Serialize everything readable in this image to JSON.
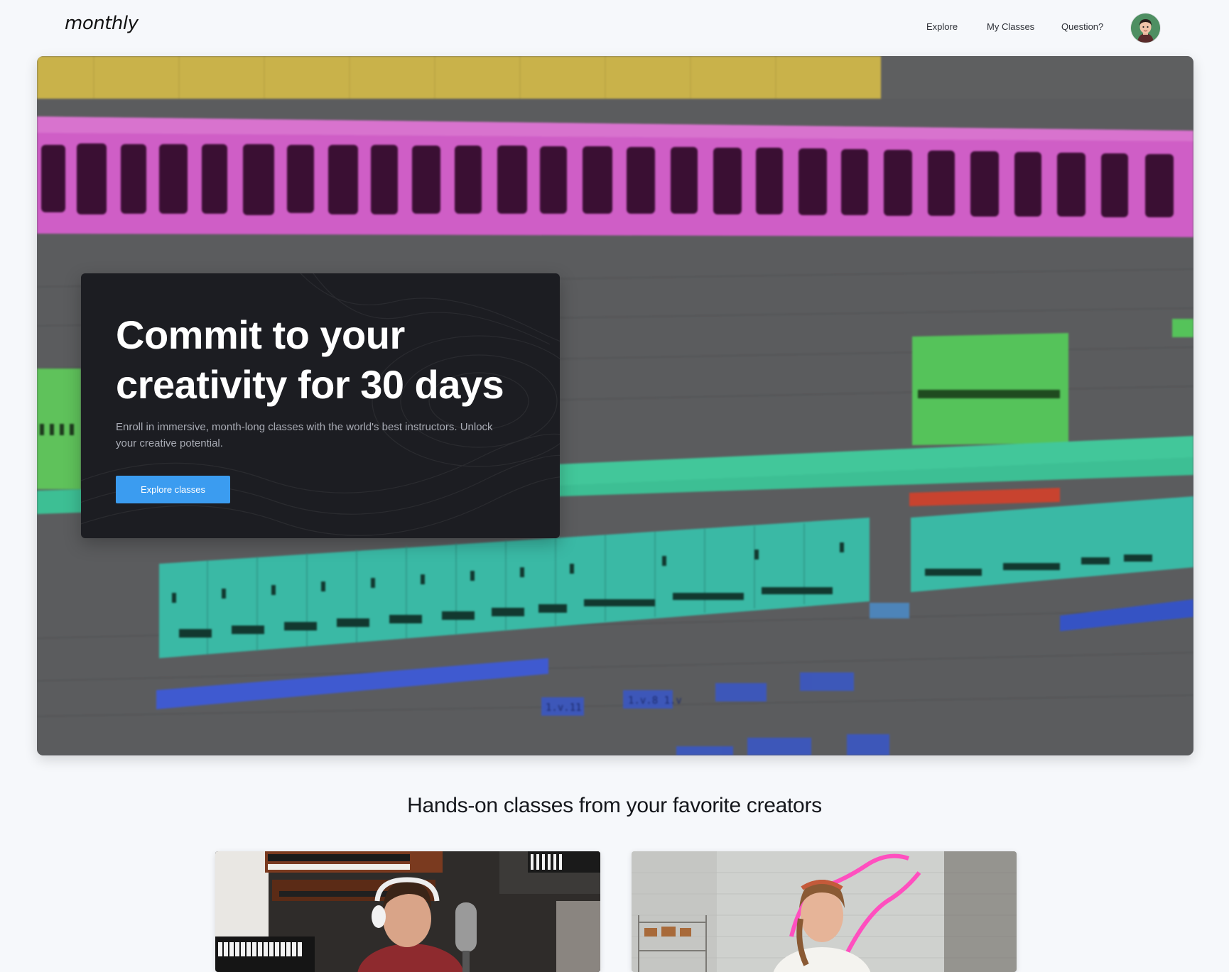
{
  "header": {
    "logo": "monthly",
    "nav": [
      "Explore",
      "My Classes",
      "Question?"
    ],
    "avatar_icon": "user-avatar-icon"
  },
  "hero": {
    "title": "Commit to your creativity for 30 days",
    "subtitle": "Enroll in immersive, month-long classes with the world's best instructors. Unlock your creative potential.",
    "button": "Explore classes"
  },
  "section": {
    "title": "Hands-on classes from your favorite creators"
  },
  "colors": {
    "accent": "#3b9cf0",
    "card_bg": "#1c1d22",
    "page_bg": "#f6f8fb"
  }
}
